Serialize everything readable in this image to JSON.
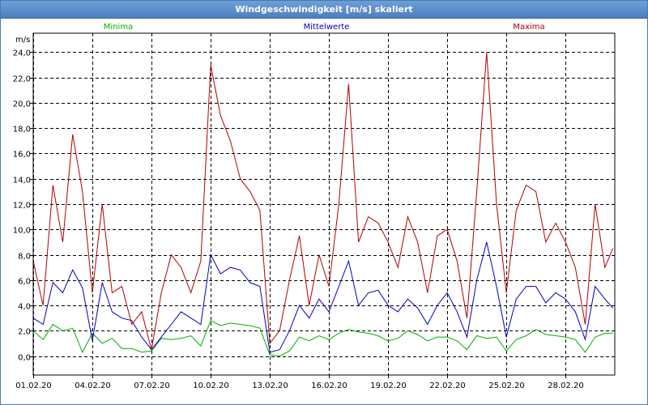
{
  "window": {
    "title": "Windgeschwindigkeit [m/s] skaliert"
  },
  "chart_data": {
    "type": "line",
    "title": "Windgeschwindigkeit [m/s] skaliert",
    "ylabel": "m/s",
    "xlabel": "",
    "ylim": [
      -1.5,
      25.5
    ],
    "xlim": [
      0,
      29.5
    ],
    "grid": true,
    "legend_placement": "top",
    "yticks": [
      "0,0",
      "2,0",
      "4,0",
      "6,0",
      "8,0",
      "10,0",
      "12,0",
      "14,0",
      "16,0",
      "18,0",
      "20,0",
      "22,0",
      "24,0"
    ],
    "xtick_positions": [
      0,
      3,
      6,
      9,
      12,
      15,
      18,
      21,
      24,
      27
    ],
    "xticks": [
      "01.02.20",
      "04.02.20",
      "07.02.20",
      "10.02.20",
      "13.02.20",
      "16.02.20",
      "19.02.20",
      "22.02.20",
      "25.02.20",
      "28.02.20"
    ],
    "x_unit": "days since 01.02.20",
    "series": [
      {
        "name": "Minima",
        "color": "#00b000",
        "x": [
          0,
          0.5,
          1,
          1.5,
          2,
          2.5,
          3,
          3.5,
          4,
          4.5,
          5,
          5.5,
          6,
          6.5,
          7,
          7.5,
          8,
          8.5,
          9,
          9.5,
          10,
          10.5,
          11,
          11.5,
          12,
          12.5,
          13,
          13.5,
          14,
          14.5,
          15,
          15.5,
          16,
          16.5,
          17,
          17.5,
          18,
          18.5,
          19,
          19.5,
          20,
          20.5,
          21,
          21.5,
          22,
          22.5,
          23,
          23.5,
          24,
          24.5,
          25,
          25.5,
          26,
          26.5,
          27,
          27.5,
          28,
          28.5,
          29,
          29.4
        ],
        "values": [
          2.0,
          1.3,
          2.5,
          2.0,
          2.2,
          0.3,
          1.8,
          1.0,
          1.4,
          0.6,
          0.6,
          0.3,
          0.4,
          1.4,
          1.3,
          1.4,
          1.6,
          0.8,
          2.8,
          2.4,
          2.6,
          2.5,
          2.4,
          2.2,
          0.1,
          0.0,
          0.4,
          1.5,
          1.2,
          1.6,
          1.3,
          1.8,
          2.1,
          1.9,
          1.8,
          1.6,
          1.2,
          1.4,
          2.0,
          1.7,
          1.2,
          1.5,
          1.5,
          1.2,
          0.5,
          1.6,
          1.4,
          1.5,
          0.4,
          1.3,
          1.6,
          2.1,
          1.7,
          1.6,
          1.5,
          1.3,
          0.3,
          1.5,
          1.8,
          1.8
        ]
      },
      {
        "name": "Mittelwerte",
        "color": "#0000c0",
        "x": [
          0,
          0.5,
          1,
          1.5,
          2,
          2.5,
          3,
          3.5,
          4,
          4.5,
          5,
          5.5,
          6,
          6.5,
          7,
          7.5,
          8,
          8.5,
          9,
          9.5,
          10,
          10.5,
          11,
          11.5,
          12,
          12.5,
          13,
          13.5,
          14,
          14.5,
          15,
          15.5,
          16,
          16.5,
          17,
          17.5,
          18,
          18.5,
          19,
          19.5,
          20,
          20.5,
          21,
          21.5,
          22,
          22.5,
          23,
          23.5,
          24,
          24.5,
          25,
          25.5,
          26,
          26.5,
          27,
          27.5,
          28,
          28.5,
          29,
          29.4
        ],
        "values": [
          3.0,
          2.5,
          5.8,
          5.0,
          6.8,
          5.4,
          1.2,
          5.8,
          3.5,
          3.0,
          2.8,
          1.5,
          0.5,
          1.5,
          2.5,
          3.5,
          3.0,
          2.5,
          8.0,
          6.5,
          7.0,
          6.8,
          5.8,
          5.5,
          0.3,
          0.5,
          2.0,
          4.0,
          3.0,
          4.5,
          3.5,
          5.5,
          7.5,
          4.0,
          5.0,
          5.2,
          4.0,
          3.5,
          4.5,
          3.8,
          2.5,
          4.0,
          5.0,
          3.5,
          1.5,
          6.0,
          9.0,
          5.5,
          1.5,
          4.5,
          5.5,
          5.5,
          4.2,
          5.0,
          4.5,
          3.5,
          1.3,
          5.5,
          4.5,
          3.8
        ]
      },
      {
        "name": "Maxima",
        "color": "#b00000",
        "x": [
          0,
          0.5,
          1,
          1.5,
          2,
          2.5,
          3,
          3.5,
          4,
          4.5,
          5,
          5.5,
          6,
          6.5,
          7,
          7.5,
          8,
          8.5,
          9,
          9.5,
          10,
          10.5,
          11,
          11.5,
          12,
          12.5,
          13,
          13.5,
          14,
          14.5,
          15,
          15.5,
          16,
          16.5,
          17,
          17.5,
          18,
          18.5,
          19,
          19.5,
          20,
          20.5,
          21,
          21.5,
          22,
          22.5,
          23,
          23.5,
          24,
          24.5,
          25,
          25.5,
          26,
          26.5,
          27,
          27.5,
          28,
          28.5,
          29,
          29.4
        ],
        "values": [
          7.5,
          4.0,
          13.5,
          9.0,
          17.5,
          13.0,
          5.0,
          12.0,
          5.0,
          5.5,
          2.5,
          3.5,
          0.5,
          5.0,
          8.0,
          7.0,
          5.0,
          7.5,
          23.0,
          19.0,
          17.0,
          14.0,
          13.0,
          11.5,
          1.0,
          2.0,
          6.0,
          9.5,
          4.0,
          8.0,
          5.5,
          12.0,
          21.5,
          9.0,
          11.0,
          10.5,
          9.0,
          7.0,
          11.0,
          9.0,
          5.0,
          9.5,
          10.0,
          7.5,
          3.0,
          13.0,
          24.0,
          12.0,
          5.0,
          11.5,
          13.5,
          13.0,
          9.0,
          10.5,
          9.0,
          7.0,
          2.5,
          12.0,
          7.0,
          8.5
        ]
      }
    ]
  }
}
